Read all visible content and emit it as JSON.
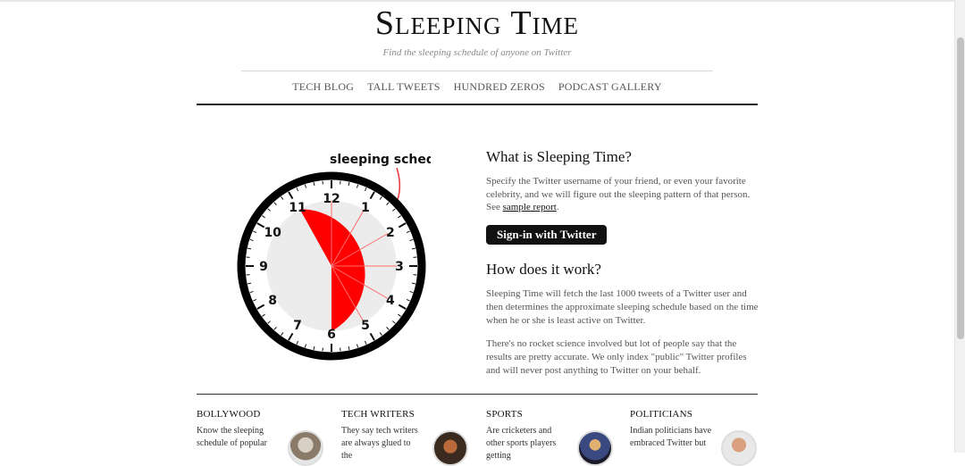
{
  "header": {
    "title": "Sleeping Time",
    "tagline": "Find the sleeping schedule of anyone on Twitter"
  },
  "nav": [
    {
      "label": "TECH BLOG"
    },
    {
      "label": "TALL TWEETS"
    },
    {
      "label": "HUNDRED ZEROS"
    },
    {
      "label": "PODCAST GALLERY"
    }
  ],
  "clock": {
    "caption": "sleeping schedule",
    "numbers": [
      "12",
      "1",
      "2",
      "3",
      "4",
      "5",
      "6",
      "7",
      "8",
      "9",
      "10",
      "11"
    ],
    "sleep_colors": {
      "sleep": "#ff0000",
      "awake": "#ececec",
      "rim": "#000000"
    }
  },
  "intro": {
    "what_heading": "What is Sleeping Time?",
    "what_text": "Specify the Twitter username of your friend, or even your favorite celebrity, and we will figure out the sleeping pattern of that person. See ",
    "sample_link": "sample report",
    "what_text_end": ".",
    "signin_label": "Sign-in with Twitter",
    "how_heading": "How does it work?",
    "how_text_1": "Sleeping Time will fetch the last 1000 tweets of a Twitter user and then determines the approximate sleeping schedule based on the time when he or she is least active on Twitter.",
    "how_text_2": "There's no rocket science involved but lot of people say that the results are pretty accurate. We only index \"public\" Twitter profiles and will never post anything to Twitter on your behalf."
  },
  "categories": [
    {
      "title": "BOLLYWOOD",
      "text": "Know the sleeping schedule of popular"
    },
    {
      "title": "TECH WRITERS",
      "text": "They say tech writers are always glued to the"
    },
    {
      "title": "SPORTS",
      "text": "Are cricketers and other sports players getting"
    },
    {
      "title": "POLITICIANS",
      "text": "Indian politicians have embraced Twitter but"
    }
  ]
}
